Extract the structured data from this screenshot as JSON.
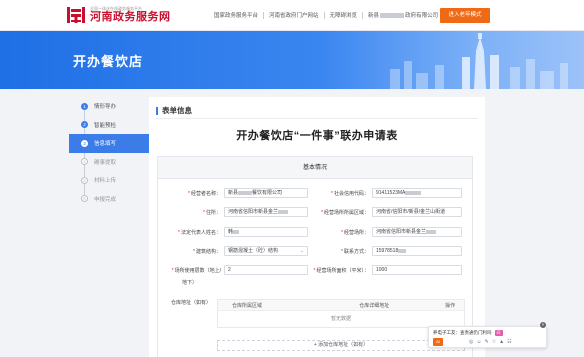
{
  "header": {
    "logo_sub": "全国一体化在线政务服务平台",
    "logo_title": "河南政务服务网",
    "links": [
      "国家政务服务平台",
      "河南省政府门户网站",
      "无障碍浏览",
      "新县",
      "政府有限公司"
    ],
    "elder_mode_label": "进入老年模式"
  },
  "banner": {
    "title": "开办餐饮店"
  },
  "steps": [
    {
      "num": "1",
      "label": "情形导办",
      "state": "done"
    },
    {
      "num": "2",
      "label": "智能预检",
      "state": "done"
    },
    {
      "num": "3",
      "label": "信息填写",
      "state": "active"
    },
    {
      "num": "4",
      "label": "确事提取",
      "state": "todo"
    },
    {
      "num": "5",
      "label": "材料上传",
      "state": "todo"
    },
    {
      "num": "6",
      "label": "申报完成",
      "state": "todo"
    }
  ],
  "panel": {
    "heading": "表单信息",
    "doc_title": "开办餐饮店“一件事”联办申请表",
    "section": "基本情况"
  },
  "form": {
    "company_name_label": "经营者名称：",
    "company_name_prefix": "新县",
    "company_name_suffix": "餐饮有限公司",
    "credit_code_label": "社会信用代码：",
    "credit_code_value": "91411523MA",
    "address_label": "住所：",
    "address_value": "河南省信阳市新县金兰",
    "biz_area_label": "经营场所所属区域：",
    "biz_area_value": "河南省/信阳市/新县/金兰山街道",
    "legal_rep_label": "法定代表人姓名：",
    "legal_rep_value": "韩",
    "biz_place_label": "经营场所：",
    "biz_place_value": "河南省信阳市新县金兰",
    "structure_label": "建筑结构：",
    "structure_value": "钢筋混凝土（砼）结构",
    "phone_label": "联系方式：",
    "phone_value": "15978518",
    "floors_label": "场所使用层数（地上/",
    "floors_label_2": "地下）",
    "floors_value": "2",
    "area_label": "经营场所面积（平米）：",
    "area_value": "1000",
    "store_label": "仓库地址（如有）",
    "table_headers": [
      "仓库所属区域",
      "仓库详细地址",
      "操作"
    ],
    "table_empty": "暂无数据",
    "add_button": "+ 添加仓库地址（如有）"
  },
  "assistant": {
    "title": "养电子工友：查责通仍门利吗",
    "tag": "问",
    "ai_label": "AI",
    "icons": [
      "◎",
      "☺",
      "✎",
      "☆",
      "▲",
      "☷"
    ],
    "close": "×"
  },
  "colors": {
    "accent": "#3c7ce8",
    "brand_red": "#c8102e",
    "orange": "#f06a16"
  }
}
